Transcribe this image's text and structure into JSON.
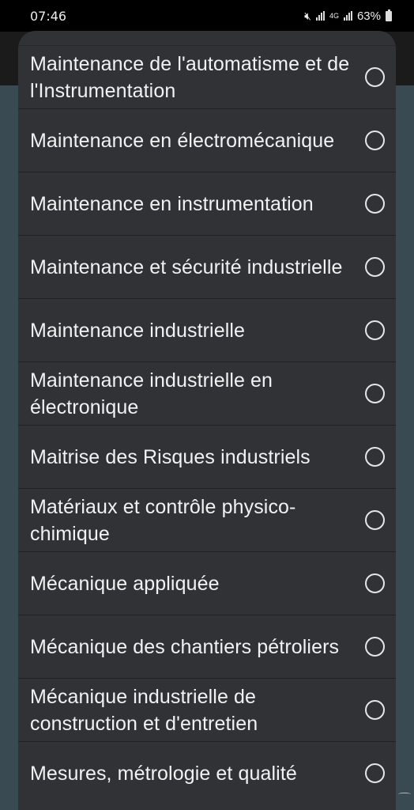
{
  "status_bar": {
    "time": "07:46",
    "network": "4G",
    "battery": "63%",
    "icons": [
      "mute-icon",
      "signal-icon",
      "signal-icon",
      "battery-icon"
    ]
  },
  "dialog": {
    "options": [
      {
        "label": "Maintenance de l'automatisme et de l'Instrumentation",
        "selected": false
      },
      {
        "label": "Maintenance en électromécanique",
        "selected": false
      },
      {
        "label": "Maintenance en instrumentation",
        "selected": false
      },
      {
        "label": "Maintenance et sécurité industrielle",
        "selected": false
      },
      {
        "label": "Maintenance industrielle",
        "selected": false
      },
      {
        "label": "Maintenance industrielle en électronique",
        "selected": false
      },
      {
        "label": "Maitrise des Risques industriels",
        "selected": false
      },
      {
        "label": "Matériaux et contrôle physico-chimique",
        "selected": false
      },
      {
        "label": "Mécanique appliquée",
        "selected": false
      },
      {
        "label": "Mécanique des chantiers pétroliers",
        "selected": false
      },
      {
        "label": "Mécanique industrielle de construction et d'entretien",
        "selected": false
      },
      {
        "label": "Mesures, métrologie et qualité",
        "selected": false
      }
    ]
  },
  "colors": {
    "dialog_bg": "#303236",
    "text": "#f2f2f2",
    "radio": "#e6e6e6",
    "status_bg": "#000000"
  }
}
